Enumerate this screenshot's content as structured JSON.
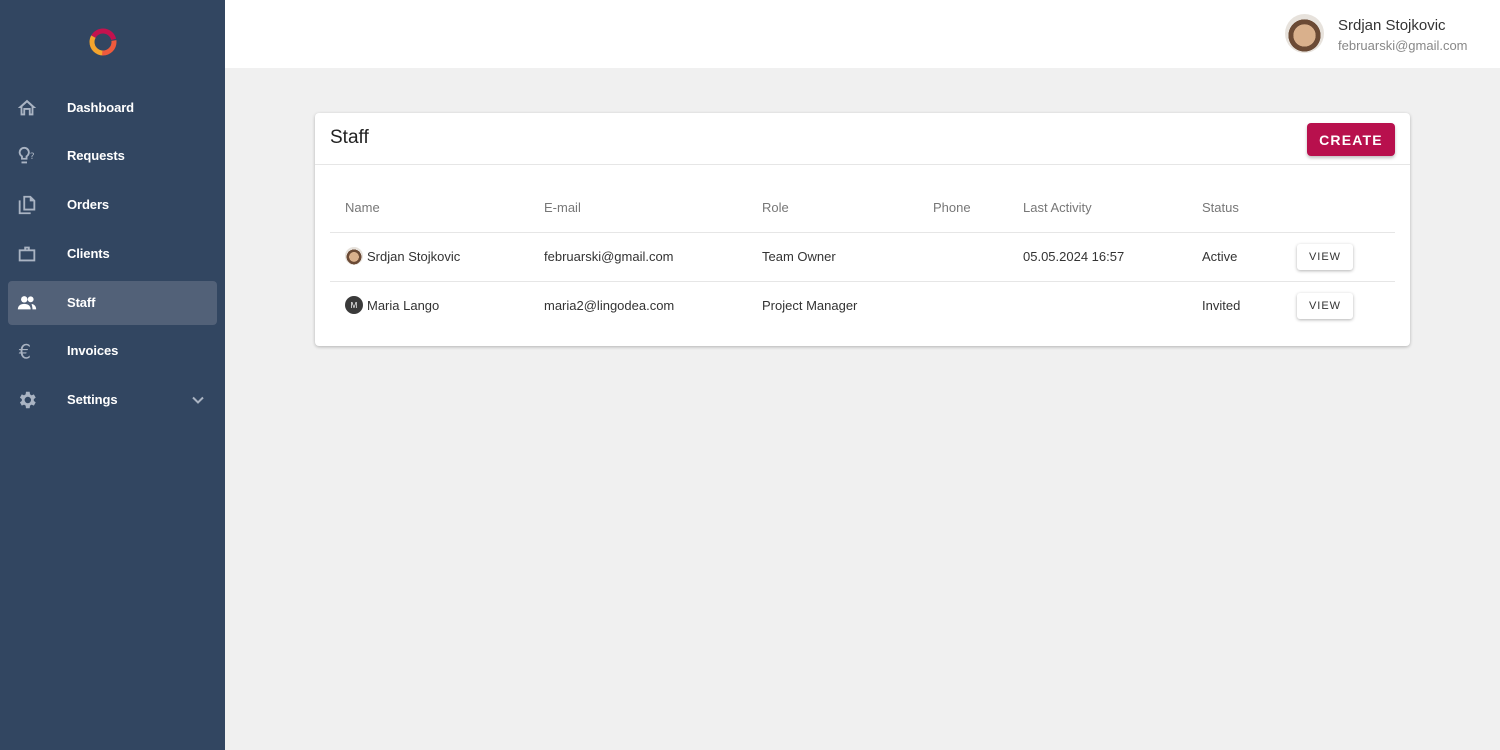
{
  "colors": {
    "sidebar_bg": "#324661",
    "sidebar_active": "#526178",
    "accent": "#b8104d",
    "page_bg": "#f0f0f0"
  },
  "sidebar": {
    "logo": "ring-logo-icon",
    "items": [
      {
        "label": "Dashboard",
        "icon": "home-icon",
        "active": false
      },
      {
        "label": "Requests",
        "icon": "lightbulb-question-icon",
        "active": false
      },
      {
        "label": "Orders",
        "icon": "documents-icon",
        "active": false
      },
      {
        "label": "Clients",
        "icon": "briefcase-icon",
        "active": false
      },
      {
        "label": "Staff",
        "icon": "people-icon",
        "active": true
      },
      {
        "label": "Invoices",
        "icon": "euro-icon",
        "active": false
      },
      {
        "label": "Settings",
        "icon": "gear-icon",
        "active": false,
        "expandable": true
      }
    ]
  },
  "header": {
    "user": {
      "name": "Srdjan Stojkovic",
      "email": "februarski@gmail.com"
    }
  },
  "card": {
    "title": "Staff",
    "create_label": "CREATE",
    "columns": [
      "Name",
      "E-mail",
      "Role",
      "Phone",
      "Last Activity",
      "Status"
    ],
    "rows": [
      {
        "avatar": "photo",
        "avatar_initial": "",
        "name": "Srdjan Stojkovic",
        "email": "februarski@gmail.com",
        "role": "Team Owner",
        "phone": "",
        "last_activity": "05.05.2024 16:57",
        "status": "Active",
        "action_label": "VIEW"
      },
      {
        "avatar": "initial",
        "avatar_initial": "M",
        "name": "Maria Lango",
        "email": "maria2@lingodea.com",
        "role": "Project Manager",
        "phone": "",
        "last_activity": "",
        "status": "Invited",
        "action_label": "VIEW"
      }
    ]
  }
}
